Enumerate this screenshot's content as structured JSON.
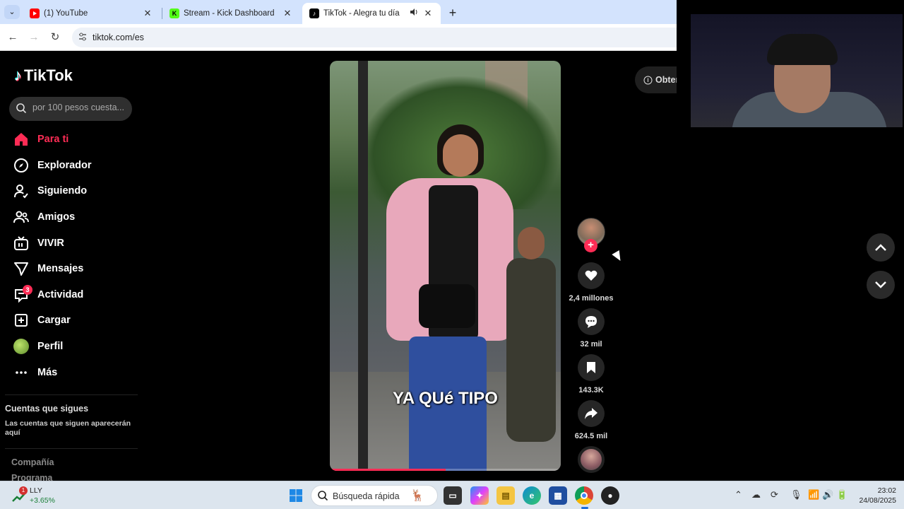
{
  "browser": {
    "tabs": [
      {
        "title": "(1) YouTube",
        "favicon": "youtube-icon",
        "active": false
      },
      {
        "title": "Stream - Kick Dashboard",
        "favicon": "kick-icon",
        "active": false
      },
      {
        "title": "TikTok - Alegra tu día",
        "favicon": "tiktok-icon",
        "active": true
      }
    ],
    "url": "tiktok.com/es"
  },
  "tiktok": {
    "brand": "TikTok",
    "search_placeholder": "por 100 pesos cuesta...",
    "nav": [
      {
        "label": "Para ti",
        "icon": "home-icon",
        "active": true
      },
      {
        "label": "Explorador",
        "icon": "compass-icon"
      },
      {
        "label": "Siguiendo",
        "icon": "following-icon"
      },
      {
        "label": "Amigos",
        "icon": "friends-icon"
      },
      {
        "label": "VIVIR",
        "icon": "live-icon"
      },
      {
        "label": "Mensajes",
        "icon": "messages-icon"
      },
      {
        "label": "Actividad",
        "icon": "activity-icon",
        "badge": "3"
      },
      {
        "label": "Cargar",
        "icon": "upload-icon"
      },
      {
        "label": "Perfil",
        "icon": "profile-avatar"
      },
      {
        "label": "Más",
        "icon": "more-icon"
      }
    ],
    "following_title": "Cuentas que sigues",
    "following_note": "Las cuentas que siguen aparecerán aquí",
    "footer_links": [
      "Compañía",
      "Programa"
    ],
    "get_app": "Obter",
    "video": {
      "caption": "YA QUé TIPO",
      "progress": 0.5
    },
    "actions": {
      "likes": "2,4 millones",
      "comments": "32 mil",
      "saves": "143.3K",
      "shares": "624.5 mil"
    }
  },
  "taskbar": {
    "stock_name": "LLY",
    "stock_change": "+3.65%",
    "stock_badge": "1",
    "search_label": "Búsqueda rápida",
    "time": "23:02",
    "date": "24/08/2025"
  },
  "colors": {
    "accent": "#fe2c55",
    "chrome_tabbar": "#d3e3fd",
    "taskbar": "#dce5ee"
  }
}
